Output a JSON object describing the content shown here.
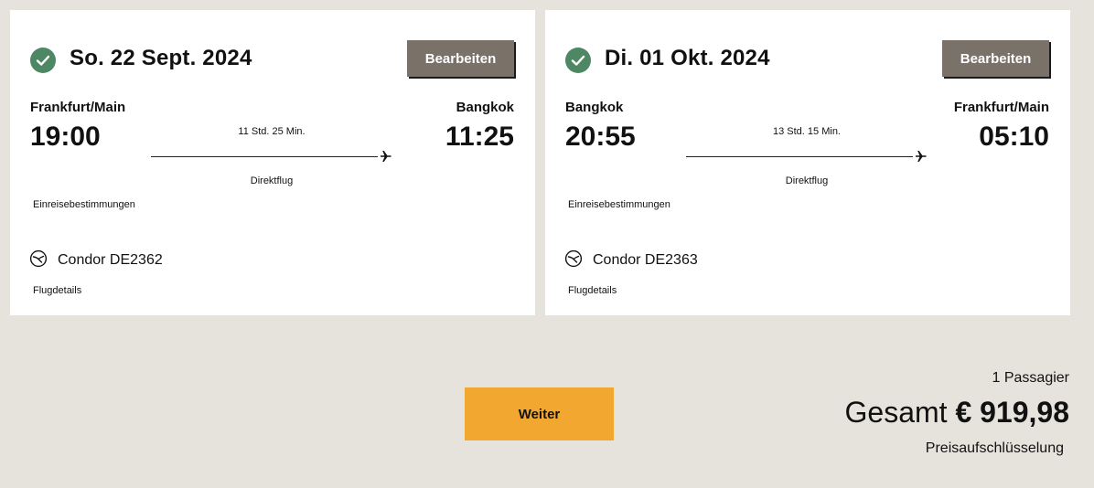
{
  "flights": [
    {
      "date": "So. 22 Sept. 2024",
      "edit_label": "Bearbeiten",
      "from_city": "Frankfurt/Main",
      "to_city": "Bangkok",
      "depart_time": "19:00",
      "arrive_time": "11:25",
      "duration": "11 Std. 25 Min.",
      "stops": "Direktflug",
      "entry_rules_label": "Einreisebestimmungen",
      "flight_number": "Condor DE2362",
      "details_label": "Flugdetails",
      "status_icon": "check-circle-icon",
      "airline_icon": "condor-logo-icon"
    },
    {
      "date": "Di. 01 Okt. 2024",
      "edit_label": "Bearbeiten",
      "from_city": "Bangkok",
      "to_city": "Frankfurt/Main",
      "depart_time": "20:55",
      "arrive_time": "05:10",
      "duration": "13 Std. 15 Min.",
      "stops": "Direktflug",
      "entry_rules_label": "Einreisebestimmungen",
      "flight_number": "Condor DE2363",
      "details_label": "Flugdetails",
      "status_icon": "check-circle-icon",
      "airline_icon": "condor-logo-icon"
    }
  ],
  "footer": {
    "continue_label": "Weiter",
    "passengers": "1 Passagier",
    "total_label": "Gesamt",
    "total_amount": "€ 919,98",
    "breakdown_label": "Preisaufschlüsselung"
  },
  "colors": {
    "background": "#e6e3dc",
    "card": "#ffffff",
    "check_green": "#4e8763",
    "edit_button": "#7a7169",
    "continue_button": "#f2a730"
  }
}
